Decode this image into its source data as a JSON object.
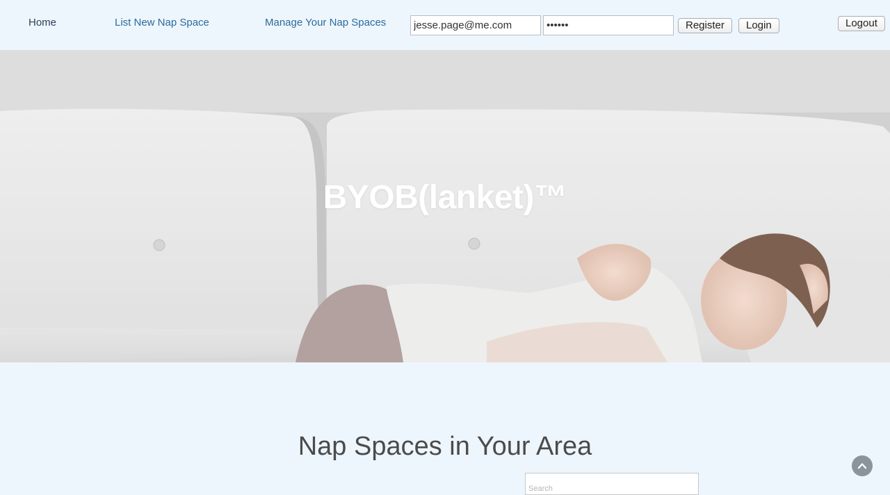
{
  "nav": {
    "home": "Home",
    "list_new": "List New Nap Space",
    "manage": "Manage Your Nap Spaces"
  },
  "auth": {
    "email_value": "jesse.page@me.com",
    "password_value": "••••••",
    "register_label": "Register",
    "login_label": "Login",
    "logout_label": "Logout"
  },
  "hero": {
    "title": "BYOB(lanket)™"
  },
  "section": {
    "title": "Nap Spaces in Your Area",
    "search_placeholder": "Search"
  },
  "icons": {
    "scroll_top": "chevron-up-icon"
  },
  "colors": {
    "page_bg": "#eef6fd",
    "link": "#2c6a9a",
    "scroll_button": "#8a949c"
  }
}
